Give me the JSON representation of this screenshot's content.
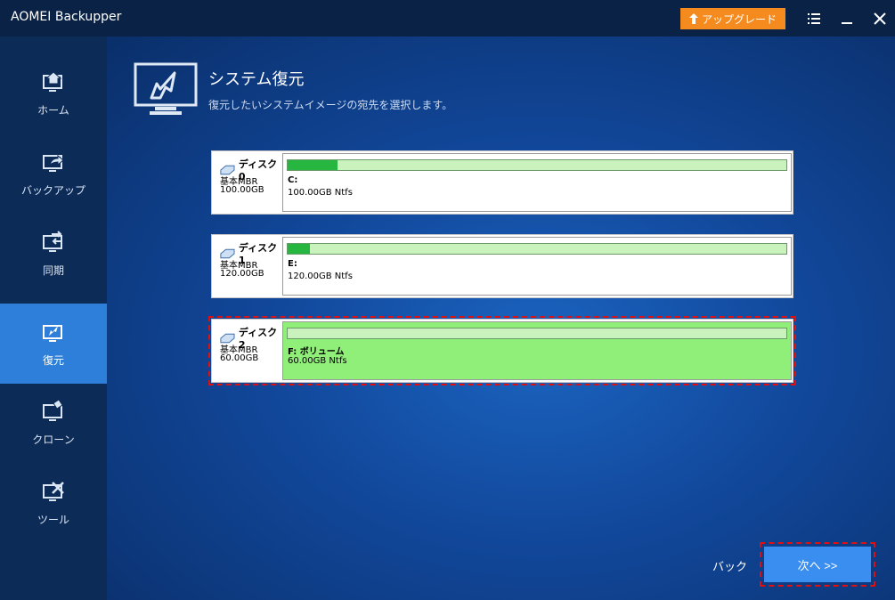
{
  "app": {
    "title": "AOMEI Backupper"
  },
  "titlebar": {
    "upgrade_label": "アップグレード"
  },
  "sidebar": {
    "items": [
      {
        "label": "ホーム"
      },
      {
        "label": "バックアップ"
      },
      {
        "label": "同期"
      },
      {
        "label": "復元"
      },
      {
        "label": "クローン"
      },
      {
        "label": "ツール"
      }
    ]
  },
  "page": {
    "title": "システム復元",
    "subtitle": "復元したいシステムイメージの宛先を選択します。"
  },
  "disks": [
    {
      "name": "ディスク0",
      "type": "基本MBR",
      "size": "100.00GB",
      "partition_label": "C:",
      "partition_detail": "100.00GB Ntfs",
      "used_fraction": 0.1
    },
    {
      "name": "ディスク1",
      "type": "基本MBR",
      "size": "120.00GB",
      "partition_label": "E:",
      "partition_detail": "120.00GB Ntfs",
      "used_fraction": 0.045
    },
    {
      "name": "ディスク2",
      "type": "基本MBR",
      "size": "60.00GB",
      "partition_label": "F: ボリューム",
      "partition_detail": "60.00GB Ntfs",
      "used_fraction": 0.0
    }
  ],
  "footer": {
    "back_label": "バック",
    "next_label": "次へ >>"
  },
  "colors": {
    "accent": "#2e7fd9",
    "upgrade": "#f58a1f",
    "selected_partition": "#90ef78",
    "used_bar": "#27b63f"
  }
}
